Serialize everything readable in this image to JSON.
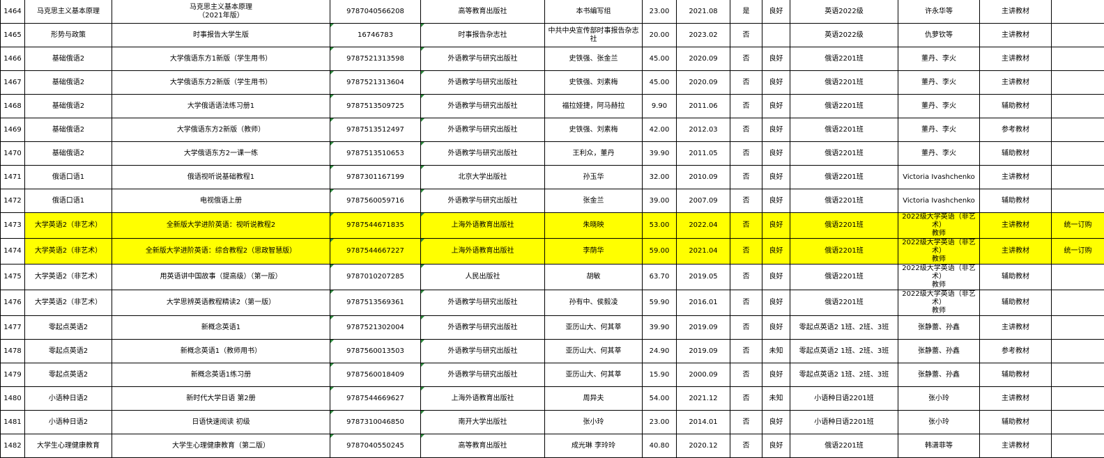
{
  "sheet": {
    "rows": [
      {
        "no": "1464",
        "course": "马克思主义基本原理",
        "book": "马克思主义基本原理\n（2021年版）",
        "isbn": "9787040566208",
        "publisher": "高等教育出版社",
        "author": "本书编写组",
        "price": "23.00",
        "date": "2021.08",
        "flag": "是",
        "quality": "良好",
        "cls": "英语2022级",
        "teacher": "许永华等",
        "type": "主讲教材",
        "note": ""
      },
      {
        "no": "1465",
        "course": "形势与政策",
        "book": "时事报告大学生版",
        "isbn": "16746783",
        "publisher": "时事报告杂志社",
        "author": "中共中央宣传部时事报告杂志\n社",
        "price": "20.00",
        "date": "2023.02",
        "flag": "否",
        "quality": "",
        "cls": "英语2022级",
        "teacher": "仇萝钦等",
        "type": "主讲教材",
        "note": ""
      },
      {
        "no": "1466",
        "course": "基础俄语2",
        "book": "大学俄语东方1新版（学生用书）",
        "isbn": "9787521313598",
        "publisher": "外语教学与研究出版社",
        "author": "史铁强、张金兰",
        "price": "45.00",
        "date": "2020.09",
        "flag": "否",
        "quality": "良好",
        "cls": "俄语2201班",
        "teacher": "董丹、李火",
        "type": "主讲教材",
        "note": ""
      },
      {
        "no": "1467",
        "course": "基础俄语2",
        "book": "大学俄语东方2新版（学生用书）",
        "isbn": "9787521313604",
        "publisher": "外语教学与研究出版社",
        "author": "史铁强、刘素梅",
        "price": "45.00",
        "date": "2020.09",
        "flag": "否",
        "quality": "良好",
        "cls": "俄语2201班",
        "teacher": "董丹、李火",
        "type": "主讲教材",
        "note": ""
      },
      {
        "no": "1468",
        "course": "基础俄语2",
        "book": "大学俄语语法练习册1",
        "isbn": "9787513509725",
        "publisher": "外语教学与研究出版社",
        "author": "福拉娅捷，阿马赫拉",
        "price": "9.90",
        "date": "2011.06",
        "flag": "否",
        "quality": "良好",
        "cls": "俄语2201班",
        "teacher": "董丹、李火",
        "type": "辅助教材",
        "note": ""
      },
      {
        "no": "1469",
        "course": "基础俄语2",
        "book": "大学俄语东方2新版（教师）",
        "isbn": "9787513512497",
        "publisher": "外语教学与研究出版社",
        "author": "史铁强、刘素梅",
        "price": "42.00",
        "date": "2012.03",
        "flag": "否",
        "quality": "良好",
        "cls": "俄语2201班",
        "teacher": "董丹、李火",
        "type": "参考教材",
        "note": ""
      },
      {
        "no": "1470",
        "course": "基础俄语2",
        "book": "大学俄语东方2一课一练",
        "isbn": "9787513510653",
        "publisher": "外语教学与研究出版社",
        "author": "王利众，董丹",
        "price": "39.90",
        "date": "2011.05",
        "flag": "否",
        "quality": "良好",
        "cls": "俄语2201班",
        "teacher": "董丹、李火",
        "type": "辅助教材",
        "note": ""
      },
      {
        "no": "1471",
        "course": "俄语口语1",
        "book": "俄语视听说基础教程1",
        "isbn": "9787301167199",
        "publisher": "北京大学出版社",
        "author": "孙玉华",
        "price": "32.00",
        "date": "2010.09",
        "flag": "否",
        "quality": "良好",
        "cls": "俄语2201班",
        "teacher": "Victoria Ivashchenko",
        "type": "主讲教材",
        "note": ""
      },
      {
        "no": "1472",
        "course": "俄语口语1",
        "book": "电视俄语上册",
        "isbn": "9787560059716",
        "publisher": "外语教学与研究出版社",
        "author": "张金兰",
        "price": "39.00",
        "date": "2007.09",
        "flag": "否",
        "quality": "良好",
        "cls": "俄语2201班",
        "teacher": "Victoria Ivashchenko",
        "type": "辅助教材",
        "note": ""
      },
      {
        "no": "1473",
        "course": "大学英语2（非艺术）",
        "book": "全新版大学进阶英语：视听说教程2",
        "isbn": "9787544671835",
        "publisher": "上海外语教育出版社",
        "author": "朱晓映",
        "price": "53.00",
        "date": "2022.04",
        "flag": "否",
        "quality": "良好",
        "cls": "俄语2201班",
        "teacher": "2022级大学英语（非艺术）\n教师",
        "type": "主讲教材",
        "note": "统一订购"
      },
      {
        "no": "1474",
        "course": "大学英语2（非艺术）",
        "book": "全新版大学进阶英语：综合教程2（思政智慧版）",
        "isbn": "9787544667227",
        "publisher": "上海外语教育出版社",
        "author": "李荫华",
        "price": "59.00",
        "date": "2021.04",
        "flag": "否",
        "quality": "良好",
        "cls": "俄语2201班",
        "teacher": "2022级大学英语（非艺术）\n教师",
        "type": "主讲教材",
        "note": "统一订购"
      },
      {
        "no": "1475",
        "course": "大学英语2（非艺术）",
        "book": "用英语讲中国故事（提高级）（第一版）",
        "isbn": "9787010207285",
        "publisher": "人民出版社",
        "author": "胡敏",
        "price": "63.70",
        "date": "2019.05",
        "flag": "否",
        "quality": "良好",
        "cls": "俄语2201班",
        "teacher": "2022级大学英语（非艺术）\n教师",
        "type": "辅助教材",
        "note": ""
      },
      {
        "no": "1476",
        "course": "大学英语2（非艺术）",
        "book": "大学思辨英语教程精读2（第一版）",
        "isbn": "9787513569361",
        "publisher": "外语教学与研究出版社",
        "author": "孙有中、侯毅凌",
        "price": "59.90",
        "date": "2016.01",
        "flag": "否",
        "quality": "良好",
        "cls": "俄语2201班",
        "teacher": "2022级大学英语（非艺术）\n教师",
        "type": "辅助教材",
        "note": ""
      },
      {
        "no": "1477",
        "course": "零起点英语2",
        "book": "新概念英语1",
        "isbn": "9787521302004",
        "publisher": "外语教学与研究出版社",
        "author": "亚历山大、何其莘",
        "price": "39.90",
        "date": "2019.09",
        "flag": "否",
        "quality": "良好",
        "cls": "零起点英语2 1班、2班、3班",
        "teacher": "张静蕾、孙鑫",
        "type": "主讲教材",
        "note": ""
      },
      {
        "no": "1478",
        "course": "零起点英语2",
        "book": "新概念英语1（教师用书）",
        "isbn": "9787560013503",
        "publisher": "外语教学与研究出版社",
        "author": "亚历山大、何其莘",
        "price": "24.90",
        "date": "2019.09",
        "flag": "否",
        "quality": "未知",
        "cls": "零起点英语2 1班、2班、3班",
        "teacher": "张静蕾、孙鑫",
        "type": "参考教材",
        "note": ""
      },
      {
        "no": "1479",
        "course": "零起点英语2",
        "book": "新概念英语1练习册",
        "isbn": "9787560018409",
        "publisher": "外语教学与研究出版社",
        "author": "亚历山大、何其莘",
        "price": "15.90",
        "date": "2000.09",
        "flag": "否",
        "quality": "良好",
        "cls": "零起点英语2 1班、2班、3班",
        "teacher": "张静蕾、孙鑫",
        "type": "辅助教材",
        "note": ""
      },
      {
        "no": "1480",
        "course": "小语种日语2",
        "book": "新时代大学日语 第2册",
        "isbn": "9787544669627",
        "publisher": "上海外语教育出版社",
        "author": "周异夫",
        "price": "54.00",
        "date": "2021.12",
        "flag": "否",
        "quality": "未知",
        "cls": "小语种日语2201班",
        "teacher": "张小玲",
        "type": "主讲教材",
        "note": ""
      },
      {
        "no": "1481",
        "course": "小语种日语2",
        "book": "日语快速阅读 初级",
        "isbn": "9787310046850",
        "publisher": "南开大学出版社",
        "author": "张小玲",
        "price": "23.00",
        "date": "2014.01",
        "flag": "否",
        "quality": "良好",
        "cls": "小语种日语2201班",
        "teacher": "张小玲",
        "type": "辅助教材",
        "note": ""
      },
      {
        "no": "1482",
        "course": "大学生心理健康教育",
        "book": "大学生心理健康教育（第二版）",
        "isbn": "9787040550245",
        "publisher": "高等教育出版社",
        "author": "成光琳 李玲玲",
        "price": "40.80",
        "date": "2020.12",
        "flag": "否",
        "quality": "良好",
        "cls": "俄语2201班",
        "teacher": "韩潇菲等",
        "type": "主讲教材",
        "note": ""
      }
    ],
    "highlight_color": "#ffff00",
    "note_marker_color": "#2e8b3e"
  }
}
